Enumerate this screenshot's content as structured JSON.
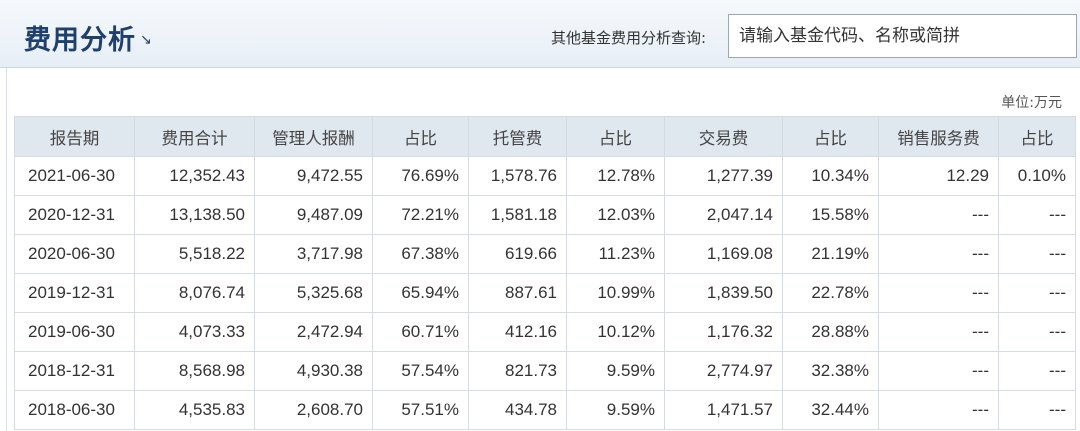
{
  "header": {
    "title": "费用分析",
    "title_arrow": "↘",
    "query_label": "其他基金费用分析查询:",
    "search_placeholder": "请输入基金代码、名称或简拼"
  },
  "unit_label": "单位:万元",
  "table": {
    "columns": [
      "报告期",
      "费用合计",
      "管理人报酬",
      "占比",
      "托管费",
      "占比",
      "交易费",
      "占比",
      "销售服务费",
      "占比"
    ],
    "rows": [
      [
        "2021-06-30",
        "12,352.43",
        "9,472.55",
        "76.69%",
        "1,578.76",
        "12.78%",
        "1,277.39",
        "10.34%",
        "12.29",
        "0.10%"
      ],
      [
        "2020-12-31",
        "13,138.50",
        "9,487.09",
        "72.21%",
        "1,581.18",
        "12.03%",
        "2,047.14",
        "15.58%",
        "---",
        "---"
      ],
      [
        "2020-06-30",
        "5,518.22",
        "3,717.98",
        "67.38%",
        "619.66",
        "11.23%",
        "1,169.08",
        "21.19%",
        "---",
        "---"
      ],
      [
        "2019-12-31",
        "8,076.74",
        "5,325.68",
        "65.94%",
        "887.61",
        "10.99%",
        "1,839.50",
        "22.78%",
        "---",
        "---"
      ],
      [
        "2019-06-30",
        "4,073.33",
        "2,472.94",
        "60.71%",
        "412.16",
        "10.12%",
        "1,176.32",
        "28.88%",
        "---",
        "---"
      ],
      [
        "2018-12-31",
        "8,568.98",
        "4,930.38",
        "57.54%",
        "821.73",
        "9.59%",
        "2,774.97",
        "32.38%",
        "---",
        "---"
      ],
      [
        "2018-06-30",
        "4,535.83",
        "2,608.70",
        "57.51%",
        "434.78",
        "9.59%",
        "1,471.57",
        "32.44%",
        "---",
        "---"
      ]
    ]
  }
}
